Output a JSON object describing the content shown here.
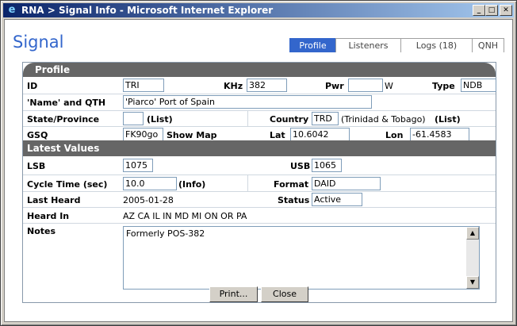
{
  "window": {
    "title": "RNA > Signal Info - Microsoft Internet Explorer",
    "controls": {
      "minimize": "_",
      "maximize": "□",
      "close": "✕"
    }
  },
  "page": {
    "title": "Signal"
  },
  "tabs": [
    {
      "label": "Profile",
      "active": true
    },
    {
      "label": "Listeners",
      "active": false
    },
    {
      "label": "Logs (18)",
      "active": false
    },
    {
      "label": "QNH",
      "active": false
    }
  ],
  "profile": {
    "heading": "Profile",
    "id_label": "ID",
    "id_value": "TRI",
    "khz_label": "KHz",
    "khz_value": "382",
    "pwr_label": "Pwr",
    "pwr_value": "",
    "pwr_unit": "W",
    "type_label": "Type",
    "type_value": "NDB",
    "name_label": "'Name' and QTH",
    "name_value": "'Piarco'  Port of Spain",
    "state_label": "State/Province",
    "state_value": "",
    "state_list": "(List)",
    "country_label": "Country",
    "country_value": "TRD",
    "country_name": "(Trinidad & Tobago)",
    "country_list": "(List)",
    "gsq_label": "GSQ",
    "gsq_value": "FK90go",
    "show_map": "Show Map",
    "lat_label": "Lat",
    "lat_value": "10.6042",
    "lon_label": "Lon",
    "lon_value": "-61.4583"
  },
  "latest": {
    "heading": "Latest Values",
    "lsb_label": "LSB",
    "lsb_value": "1075",
    "usb_label": "USB",
    "usb_value": "1065",
    "cycle_label": "Cycle Time (sec)",
    "cycle_value": "10.0",
    "cycle_info": "(Info)",
    "format_label": "Format",
    "format_value": "DAID",
    "last_heard_label": "Last Heard",
    "last_heard_value": "2005-01-28",
    "status_label": "Status",
    "status_value": "Active",
    "heard_in_label": "Heard In",
    "heard_in_value": "AZ CA IL IN MD MI ON OR PA",
    "notes_label": "Notes",
    "notes_value": "Formerly POS-382"
  },
  "buttons": {
    "print": "Print...",
    "close": "Close"
  },
  "colors": {
    "accent": "#3366cc",
    "section": "#666666",
    "titlebar": "#0a246a"
  }
}
